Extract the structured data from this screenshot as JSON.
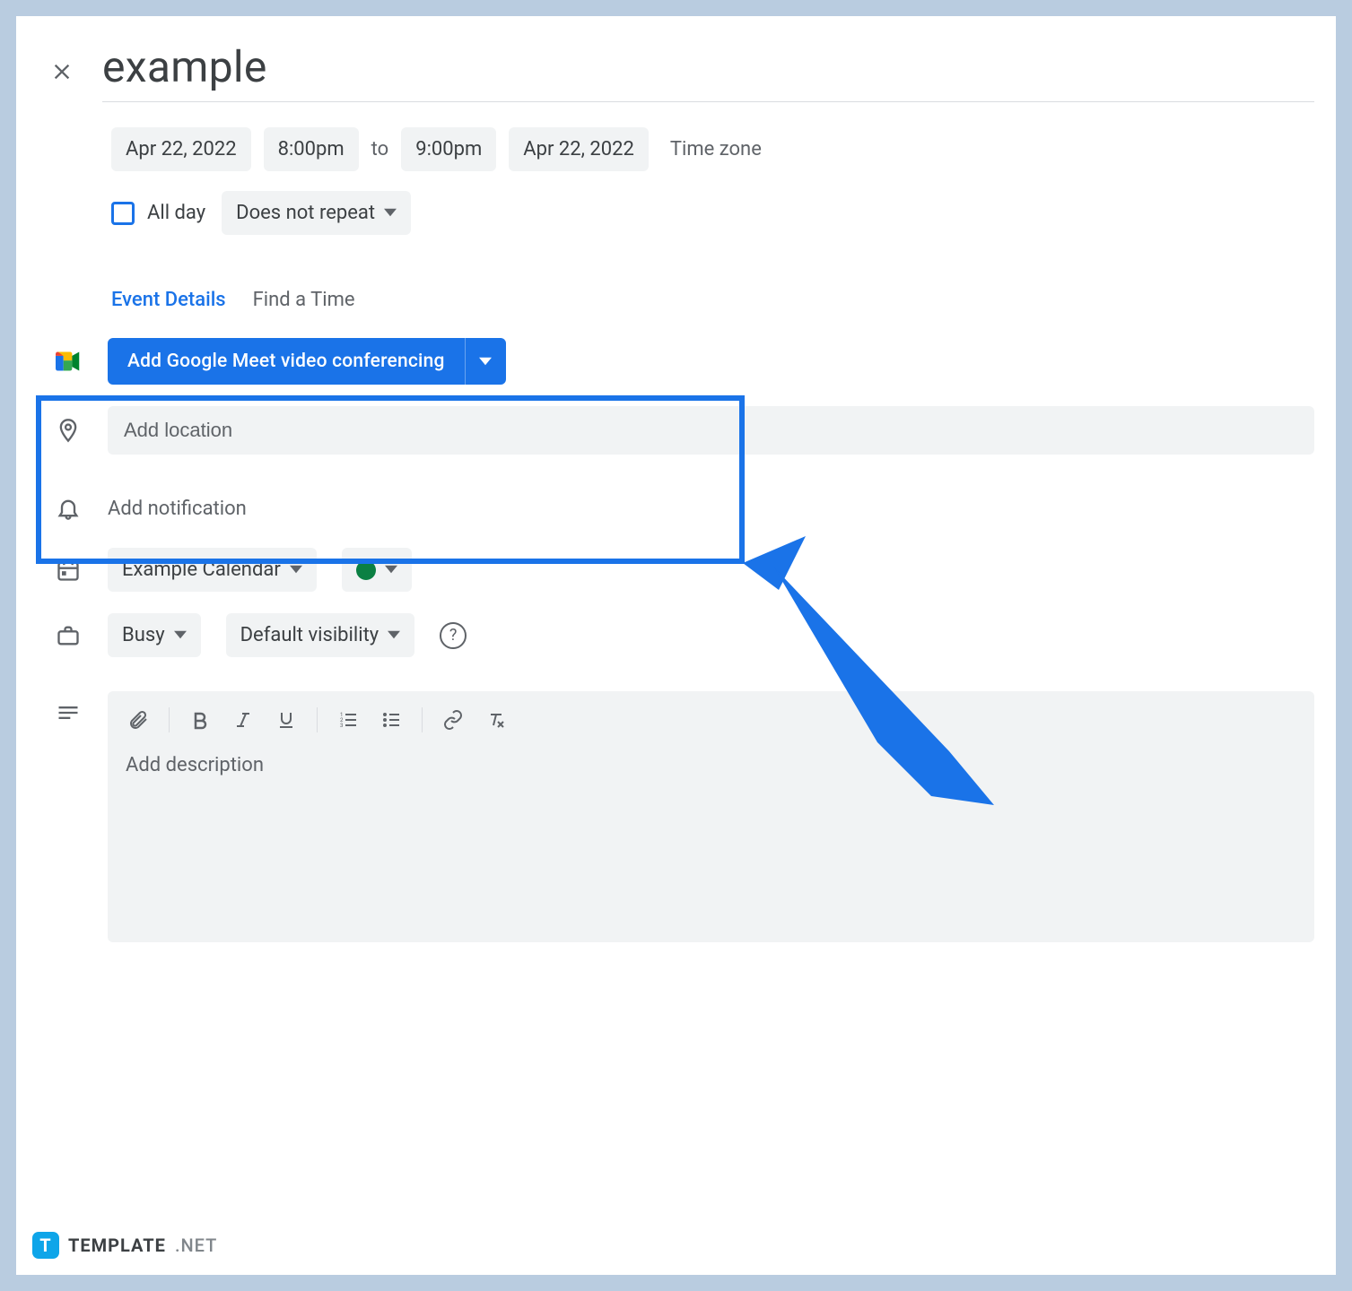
{
  "header": {
    "title": "example"
  },
  "datetime": {
    "start_date": "Apr 22, 2022",
    "start_time": "8:00pm",
    "to_label": "to",
    "end_time": "9:00pm",
    "end_date": "Apr 22, 2022",
    "timezone_label": "Time zone"
  },
  "allday": {
    "label": "All day",
    "checked": false
  },
  "recurrence": {
    "label": "Does not repeat"
  },
  "tabs": {
    "details": "Event Details",
    "find_time": "Find a Time"
  },
  "meet": {
    "button_label": "Add Google Meet video conferencing"
  },
  "location": {
    "placeholder": "Add location"
  },
  "notification": {
    "label": "Add notification"
  },
  "calendar": {
    "name": "Example Calendar",
    "color": "#0b8043"
  },
  "availability": {
    "status": "Busy",
    "visibility": "Default visibility"
  },
  "description": {
    "placeholder": "Add description"
  },
  "brand": {
    "logo_letter": "T",
    "name": "TEMPLATE",
    "suffix": ".NET"
  }
}
